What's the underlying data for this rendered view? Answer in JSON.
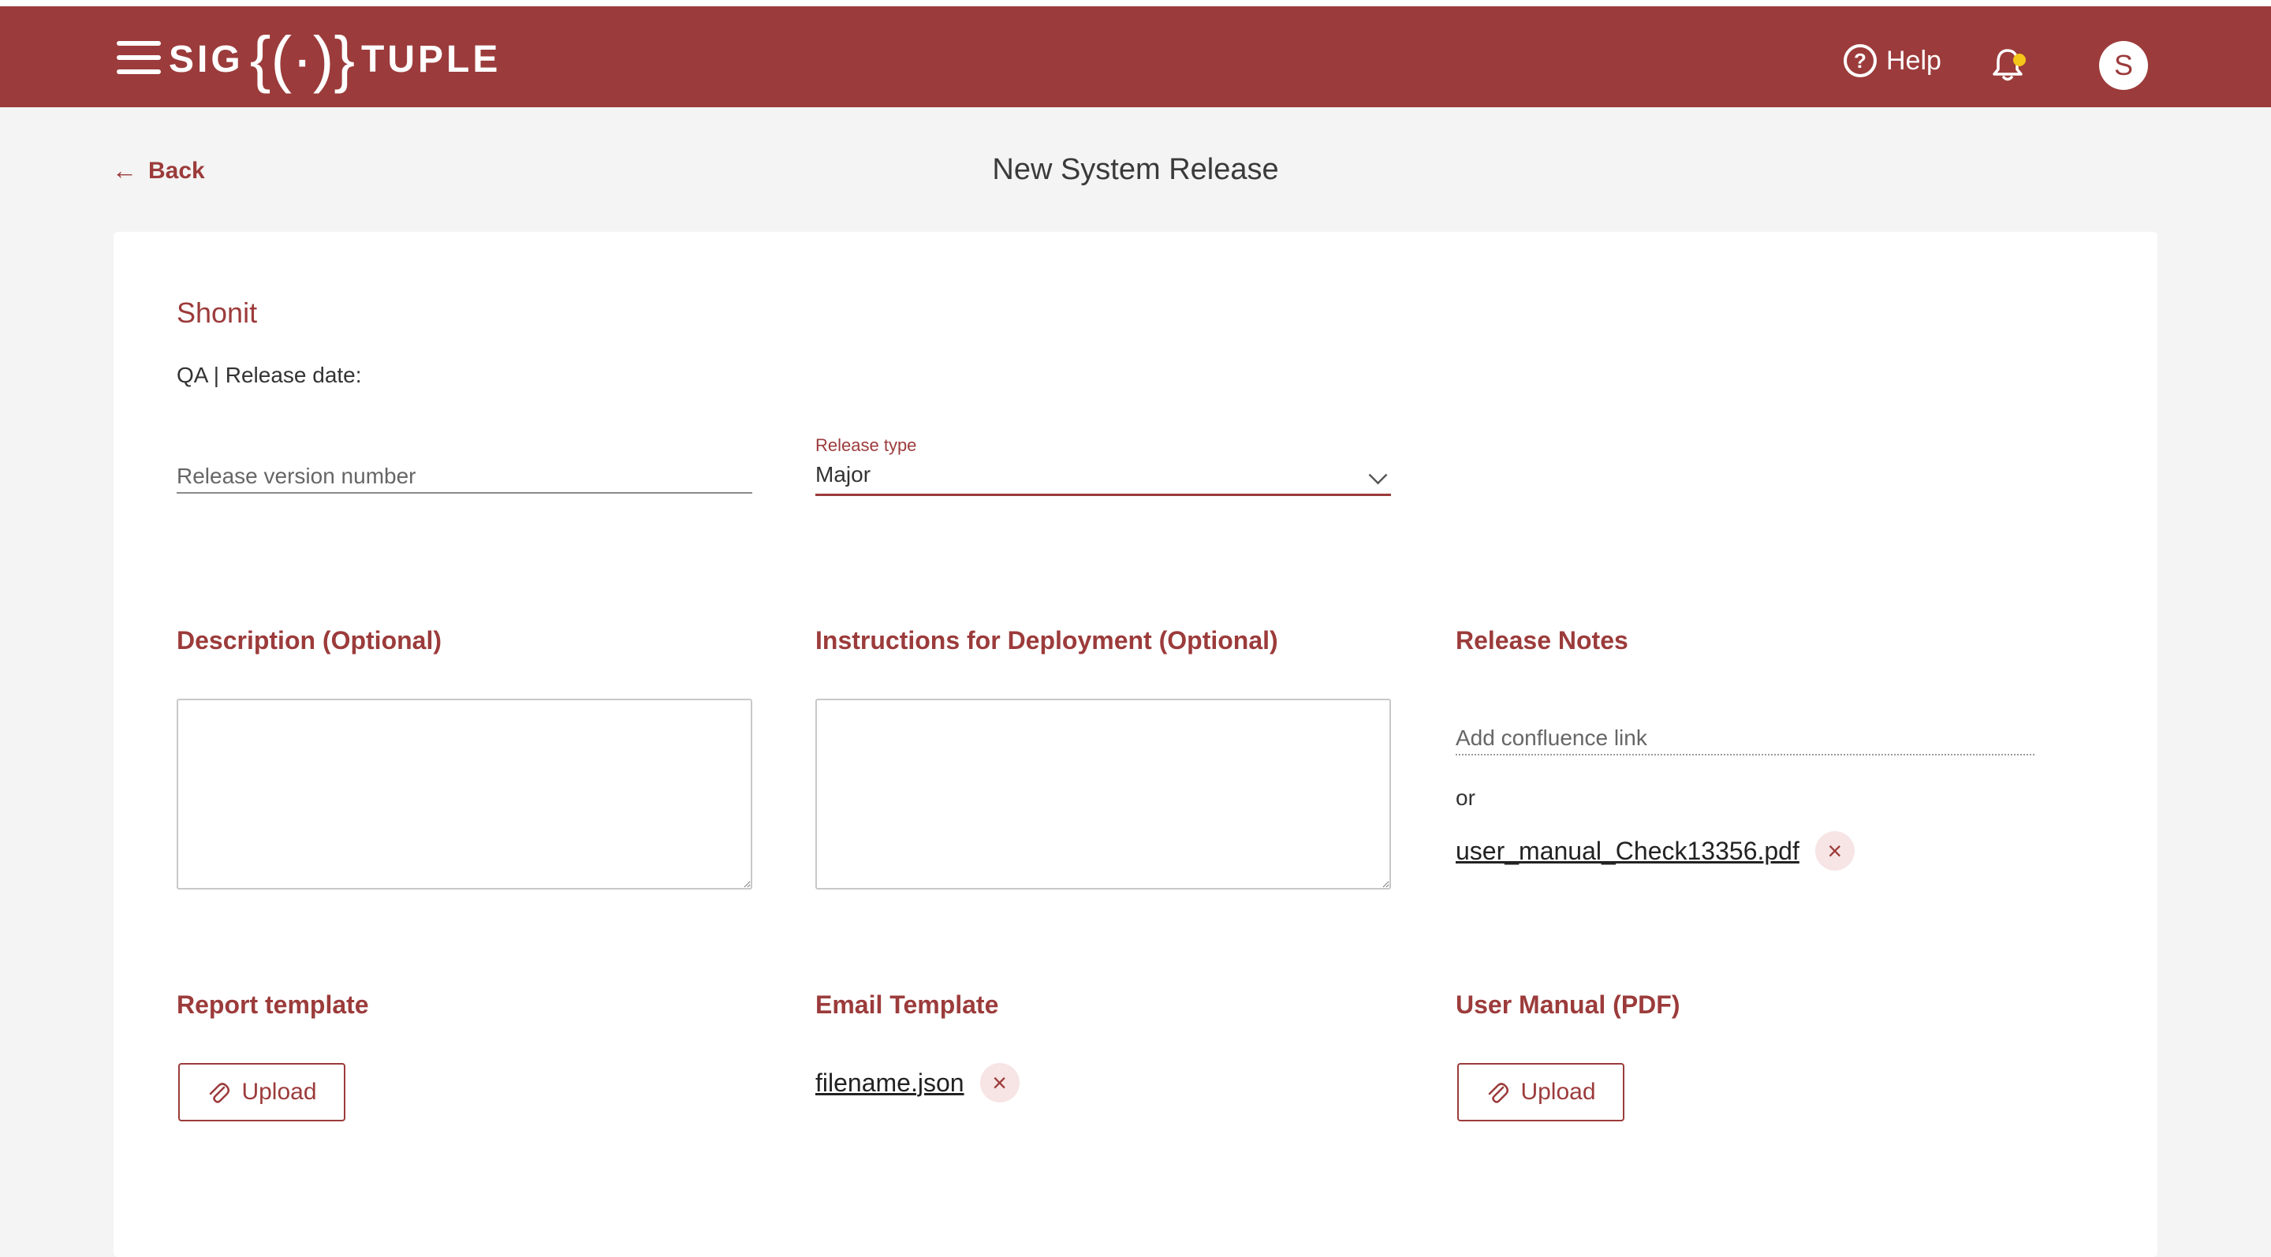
{
  "header": {
    "logo_left": "SIG",
    "logo_mark": "{(·)}",
    "logo_right": "TUPLE",
    "help_label": "Help",
    "avatar_initial": "S",
    "accent_color": "#9c3b3b",
    "notification_dot_color": "#f5c518"
  },
  "nav": {
    "back_label": "Back"
  },
  "page": {
    "title": "New System Release"
  },
  "form": {
    "product_name": "Shonit",
    "release_meta": "QA | Release date:",
    "version": {
      "placeholder": "Release version number",
      "value": ""
    },
    "release_type": {
      "label": "Release type",
      "value": "Major"
    },
    "description": {
      "label": "Description (Optional)",
      "value": ""
    },
    "instructions": {
      "label": "Instructions for Deployment (Optional)",
      "value": ""
    },
    "release_notes": {
      "label": "Release Notes",
      "link_placeholder": "Add confluence link",
      "or_text": "or",
      "file_name": "user_manual_Check13356.pdf"
    },
    "report_template": {
      "label": "Report template",
      "button_label": "Upload"
    },
    "email_template": {
      "label": "Email Template",
      "file_name": "filename.json"
    },
    "user_manual": {
      "label": "User Manual (PDF)",
      "button_label": "Upload"
    }
  }
}
